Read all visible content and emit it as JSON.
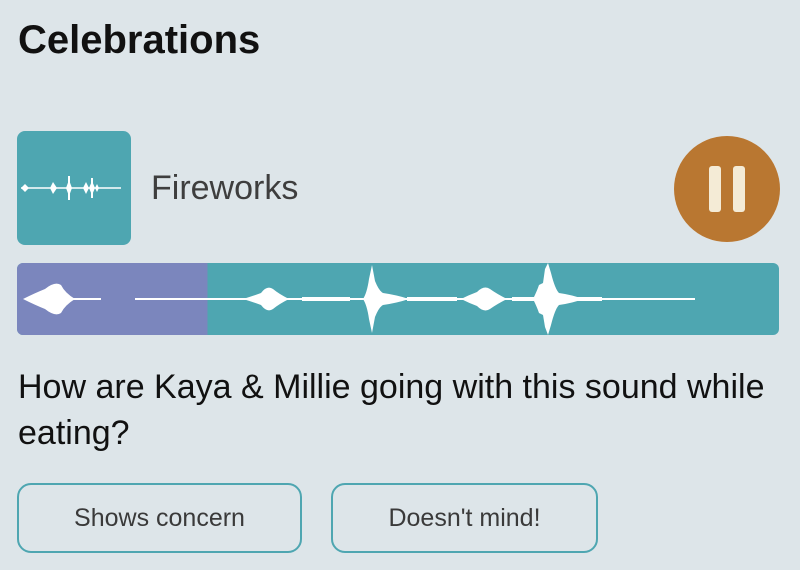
{
  "section": {
    "title": "Celebrations"
  },
  "player": {
    "sound_name": "Fireworks",
    "thumbnail_icon": "waveform-thumbnail-icon",
    "control_icon": "pause-icon",
    "state": "playing",
    "progress": 0.25
  },
  "question": {
    "text": "How are Kaya & Millie going with this sound while eating?"
  },
  "answers": [
    {
      "label": "Shows concern"
    },
    {
      "label": "Doesn't mind!"
    }
  ],
  "colors": {
    "background": "#dde5e9",
    "teal": "#4ea6b1",
    "played": "#7b86bd",
    "pause_button": "#b97731",
    "pause_glyph": "#f4ebd6",
    "button_border": "#4ea6b1"
  }
}
